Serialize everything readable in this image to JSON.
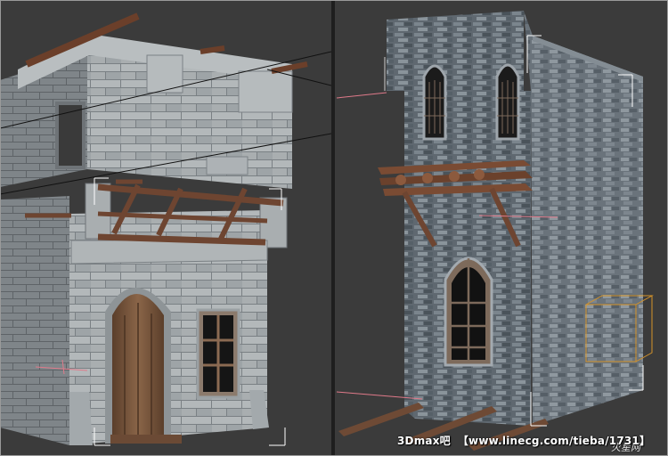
{
  "viewports": [
    {
      "id": "left",
      "label": "perspective-viewport-left"
    },
    {
      "id": "right",
      "label": "perspective-viewport-right"
    }
  ],
  "watermark": {
    "brand": "3Dmax吧",
    "url": "【www.linecg.com/tieba/1731】"
  },
  "logo": {
    "text": "火星网"
  },
  "colors": {
    "background": "#3b3b3b",
    "selection_bracket": "#ffffff",
    "gizmo_orange": "#d4932a",
    "axis_pink": "#e07a8a"
  }
}
